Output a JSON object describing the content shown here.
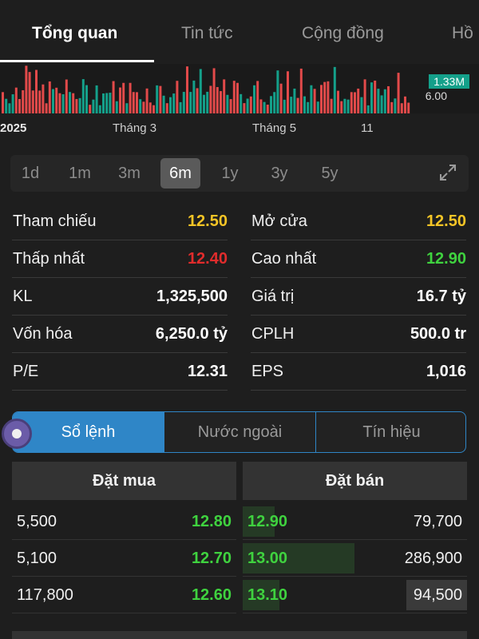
{
  "tabs": [
    "Tổng quan",
    "Tin tức",
    "Cộng đồng",
    "Hồ"
  ],
  "chart": {
    "volume_badge": "1.33M",
    "axis_label": "6.00",
    "colors": {
      "up": "#14a08a",
      "down": "#e24a4a"
    }
  },
  "timeline": [
    "2025",
    "Tháng 3",
    "Tháng 5",
    "11"
  ],
  "ranges": [
    "1d",
    "1m",
    "3m",
    "6m",
    "1y",
    "3y",
    "5y"
  ],
  "selected_range": "6m",
  "stats": [
    {
      "l_label": "Tham chiếu",
      "l_value": "12.50",
      "r_label": "Mở cửa",
      "r_value": "12.50"
    },
    {
      "l_label": "Thấp nhất",
      "l_value": "12.40",
      "r_label": "Cao nhất",
      "r_value": "12.90"
    },
    {
      "l_label": "KL",
      "l_value": "1,325,500",
      "r_label": "Giá trị",
      "r_value": "16.7 tỷ"
    },
    {
      "l_label": "Vốn hóa",
      "l_value": "6,250.0 tỷ",
      "r_label": "CPLH",
      "r_value": "500.0 tr"
    },
    {
      "l_label": "P/E",
      "l_value": "12.31",
      "r_label": "EPS",
      "r_value": "1,016"
    }
  ],
  "segments": [
    "Sổ lệnh",
    "Nước ngoài",
    "Tín hiệu"
  ],
  "orderbook": {
    "buy_title": "Đặt mua",
    "sell_title": "Đặt bán",
    "rows": [
      {
        "buy_qty": "5,500",
        "buy_price": "12.80",
        "sell_price": "12.90",
        "sell_qty": "79,700"
      },
      {
        "buy_qty": "5,100",
        "buy_price": "12.70",
        "sell_price": "13.00",
        "sell_qty": "286,900"
      },
      {
        "buy_qty": "117,800",
        "buy_price": "12.60",
        "sell_price": "13.10",
        "sell_qty": "94,500"
      }
    ]
  }
}
